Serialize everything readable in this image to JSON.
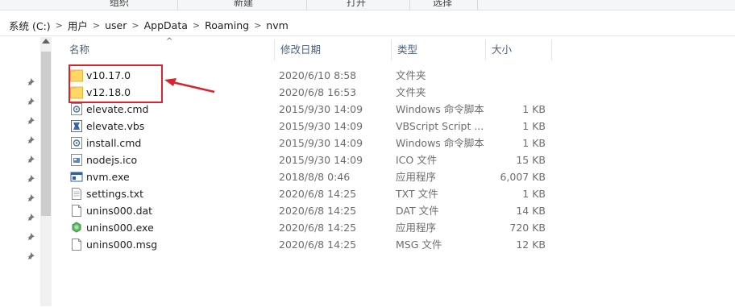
{
  "ribbon": {
    "groups": [
      "组织",
      "新建",
      "打开",
      "选择"
    ]
  },
  "address": {
    "crumbs": [
      "系统 (C:)",
      "用户",
      "user",
      "AppData",
      "Roaming",
      "nvm"
    ],
    "separator": ">"
  },
  "columns": {
    "name": "名称",
    "date": "修改日期",
    "type": "类型",
    "size": "大小",
    "sort_indicator": "^"
  },
  "files": [
    {
      "name": "v10.17.0",
      "date": "2020/6/10 8:58",
      "type": "文件夹",
      "size": "",
      "icon": "folder-icon"
    },
    {
      "name": "v12.18.0",
      "date": "2020/6/8 16:53",
      "type": "文件夹",
      "size": "",
      "icon": "folder-icon"
    },
    {
      "name": "elevate.cmd",
      "date": "2015/9/30 14:09",
      "type": "Windows 命令脚本",
      "size": "1 KB",
      "icon": "cmd-file-icon"
    },
    {
      "name": "elevate.vbs",
      "date": "2015/9/30 14:09",
      "type": "VBScript Script ...",
      "size": "1 KB",
      "icon": "vbs-file-icon"
    },
    {
      "name": "install.cmd",
      "date": "2015/9/30 14:09",
      "type": "Windows 命令脚本",
      "size": "1 KB",
      "icon": "cmd-file-icon"
    },
    {
      "name": "nodejs.ico",
      "date": "2015/9/30 14:09",
      "type": "ICO 文件",
      "size": "15 KB",
      "icon": "ico-file-icon"
    },
    {
      "name": "nvm.exe",
      "date": "2018/8/8 0:46",
      "type": "应用程序",
      "size": "6,007 KB",
      "icon": "exe-file-icon"
    },
    {
      "name": "settings.txt",
      "date": "2020/6/8 14:25",
      "type": "TXT 文件",
      "size": "1 KB",
      "icon": "txt-file-icon"
    },
    {
      "name": "unins000.dat",
      "date": "2020/6/8 14:25",
      "type": "DAT 文件",
      "size": "14 KB",
      "icon": "dat-file-icon"
    },
    {
      "name": "unins000.exe",
      "date": "2020/6/8 14:25",
      "type": "应用程序",
      "size": "720 KB",
      "icon": "installer-exe-icon"
    },
    {
      "name": "unins000.msg",
      "date": "2020/6/8 14:25",
      "type": "MSG 文件",
      "size": "12 KB",
      "icon": "msg-file-icon"
    }
  ],
  "colors": {
    "annotation": "#d9232d",
    "folder": "#ffd767",
    "header_text": "#4c607a"
  }
}
